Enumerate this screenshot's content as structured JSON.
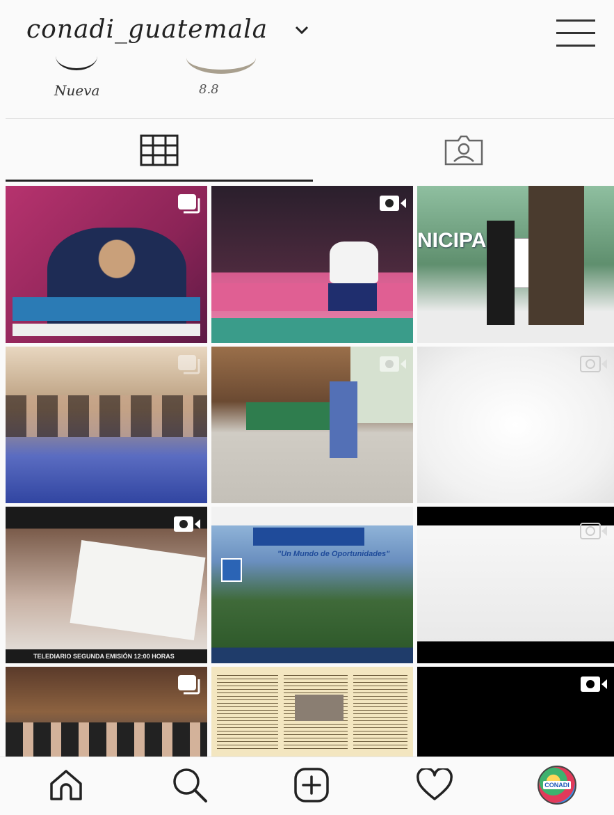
{
  "profile": {
    "username": "conadi_guatemala"
  },
  "highlights": [
    {
      "label": "Nueva"
    },
    {
      "label": "8.8"
    }
  ],
  "tabs": [
    {
      "name": "posts-grid",
      "icon": "grid-icon",
      "active": true
    },
    {
      "name": "tagged",
      "icon": "tagged-photos-icon",
      "active": false
    }
  ],
  "posts": [
    {
      "badge": "carousel-icon",
      "overlay_text": ""
    },
    {
      "badge": "video-icon",
      "overlay_text": ""
    },
    {
      "badge": "",
      "overlay_text": "NICIPA"
    },
    {
      "badge": "carousel-icon",
      "overlay_text": ""
    },
    {
      "badge": "video-icon",
      "overlay_text": ""
    },
    {
      "badge": "video-icon",
      "overlay_text": ""
    },
    {
      "badge": "video-icon",
      "overlay_text": "TELEDIARIO SEGUNDA EMISIÓN 12:00 HORAS"
    },
    {
      "badge": "",
      "overlay_text": "\"Un Mundo de Oportunidades\""
    },
    {
      "badge": "video-icon",
      "overlay_text": ""
    },
    {
      "badge": "carousel-icon",
      "overlay_text": ""
    },
    {
      "badge": "",
      "overlay_text": ""
    },
    {
      "badge": "video-icon",
      "overlay_text": ""
    }
  ],
  "bottom_nav": [
    {
      "name": "home",
      "icon": "home-icon"
    },
    {
      "name": "search",
      "icon": "search-icon"
    },
    {
      "name": "new-post",
      "icon": "add-post-icon"
    },
    {
      "name": "activity",
      "icon": "heart-icon"
    },
    {
      "name": "profile",
      "icon": "profile-avatar",
      "avatar_text": "CONADI"
    }
  ],
  "colors": {
    "background": "#fafafa",
    "text": "#222222"
  }
}
